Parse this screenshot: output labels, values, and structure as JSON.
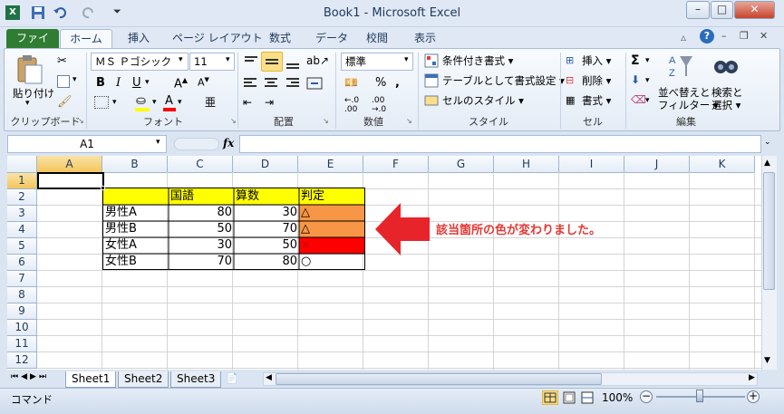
{
  "window": {
    "title": "Book1 - Microsoft Excel"
  },
  "tabs": [
    "ファイル",
    "ホーム",
    "挿入",
    "ページ レイアウト",
    "数式",
    "データ",
    "校閲",
    "表示"
  ],
  "ribbon": {
    "clipboard": {
      "paste": "貼り付け",
      "label": "クリップボード"
    },
    "font": {
      "name": "ＭＳ Ｐゴシック",
      "size": "11",
      "label": "フォント"
    },
    "alignment": {
      "label": "配置"
    },
    "number": {
      "format": "標準",
      "label": "数値"
    },
    "styles": {
      "conditional": "条件付き書式",
      "table": "テーブルとして書式設定",
      "cell_style": "セルのスタイル",
      "label": "スタイル"
    },
    "cells": {
      "insert": "挿入",
      "delete": "削除",
      "format": "書式",
      "label": "セル"
    },
    "editing": {
      "sort_filter": "並べ替えと",
      "sort_filter2": "フィルター",
      "find": "検索と",
      "find2": "選択",
      "label": "編集"
    }
  },
  "formula_bar": {
    "name_box": "A1",
    "fx": "fx",
    "value": ""
  },
  "columns": [
    "A",
    "B",
    "C",
    "D",
    "E",
    "F",
    "G",
    "H",
    "I",
    "J",
    "K"
  ],
  "rows": [
    "1",
    "2",
    "3",
    "4",
    "5",
    "6",
    "7",
    "8",
    "9",
    "10",
    "11",
    "12"
  ],
  "table": {
    "headers": [
      "",
      "国語",
      "算数",
      "判定"
    ],
    "rows": [
      [
        "男性A",
        "80",
        "30",
        "△"
      ],
      [
        "男性B",
        "50",
        "70",
        "△"
      ],
      [
        "女性A",
        "30",
        "50",
        "×"
      ],
      [
        "女性B",
        "70",
        "80",
        "○"
      ]
    ]
  },
  "annotation": "該当箇所の色が変わりました。",
  "sheets": [
    "Sheet1",
    "Sheet2",
    "Sheet3"
  ],
  "status": {
    "mode": "コマンド",
    "zoom": "100%"
  },
  "colors": {
    "header_yellow": "#ffff00",
    "orange": "#f79646",
    "red": "#ff0000",
    "file_tab": "#2f7d32"
  }
}
